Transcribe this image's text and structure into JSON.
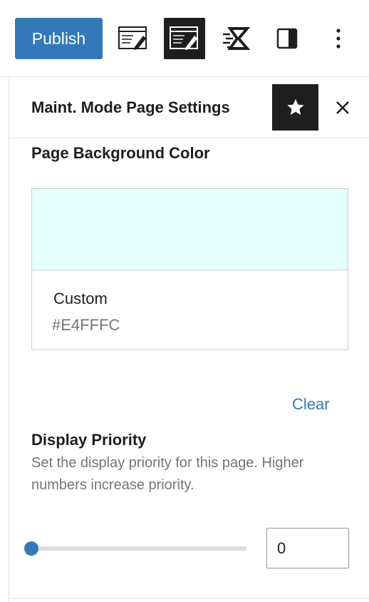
{
  "toolbar": {
    "publish_label": "Publish",
    "icons": {
      "page_editor": "page-editor-icon",
      "active_editor": "edit-page-icon",
      "plugin": "lightning-k-icon",
      "sidebar_toggle": "sidebar-toggle-icon",
      "options": "more-vertical-icon"
    }
  },
  "panel": {
    "title": "Maint. Mode Page Settings",
    "pin_icon": "star-icon",
    "close_icon": "close-icon",
    "background": {
      "label": "Page Background Color",
      "color_name": "Custom",
      "color_hex": "#E4FFFC",
      "swatch_color": "#E4FFFC",
      "clear_label": "Clear"
    },
    "priority": {
      "label": "Display Priority",
      "help": "Set the display priority for this page. Higher numbers increase priority.",
      "value": "0",
      "slider_fraction": 0
    }
  },
  "colors": {
    "accent": "#3379b9",
    "dark": "#1e1e1e",
    "muted": "#757575",
    "border": "#e0e0e0"
  }
}
